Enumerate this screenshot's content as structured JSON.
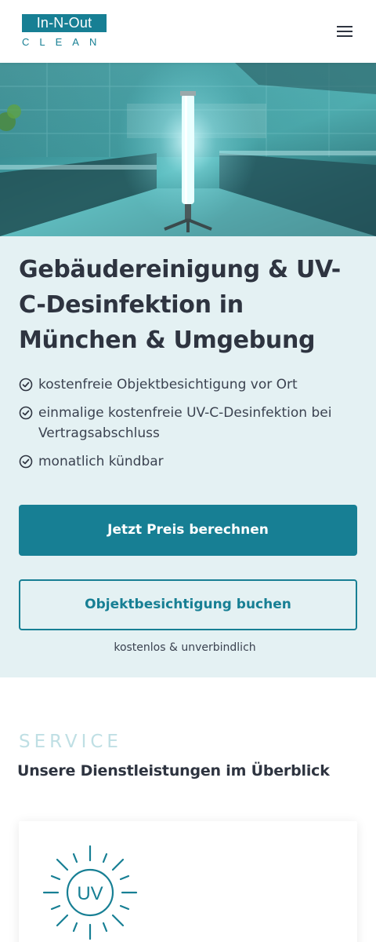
{
  "header": {
    "logo_main": "In-N-Out",
    "logo_sub": "CLEAN",
    "menu_icon": "hamburger-menu-icon"
  },
  "hero": {
    "image_description_icon": "uv-lamp-kitchen-image",
    "title": "Gebäudereinigung & UV-C-Desinfektion in München & Umgebung",
    "features": [
      "kostenfreie Objektbesichtigung vor Ort",
      "einmalige kostenfreie UV-C-Desinfektion bei Vertragsabschluss",
      "monatlich kündbar"
    ],
    "feature_icon": "check-circle-icon",
    "primary_button": "Jetzt Preis berechnen",
    "secondary_button": "Objektbesichtigung buchen",
    "button_note": "kostenlos & unverbindlich"
  },
  "services": {
    "eyebrow": "SERVICE",
    "heading": "Unsere Dienstleistungen im Überblick",
    "card_icon_text": "UV"
  },
  "colors": {
    "brand": "#177f94",
    "hero_bg": "#e4f1f3",
    "text": "#2e3440",
    "eyebrow": "#bfdfe4"
  }
}
